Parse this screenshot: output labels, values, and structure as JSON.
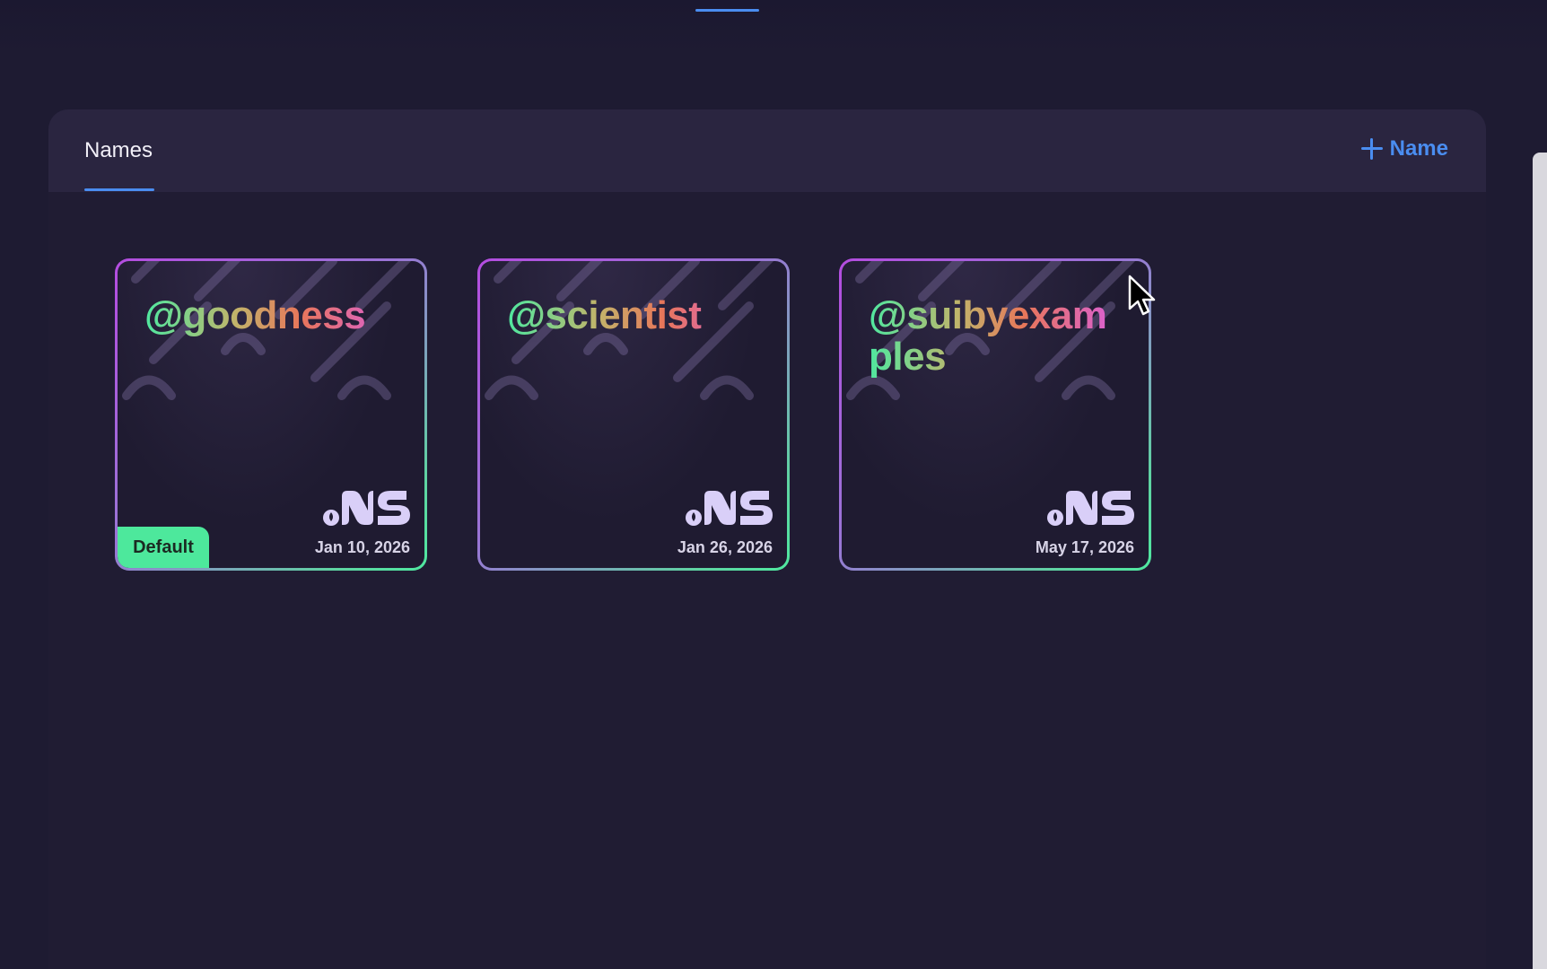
{
  "panel": {
    "tab_label": "Names",
    "add_button_label": "Name"
  },
  "cards": [
    {
      "handle": "@goodness",
      "date": "Jan 10, 2026",
      "is_default": true,
      "badge_label": "Default"
    },
    {
      "handle": "@scientist",
      "date": "Jan 26, 2026",
      "is_default": false
    },
    {
      "handle": "@suibyexamples",
      "date": "May 17, 2026",
      "is_default": false
    }
  ],
  "colors": {
    "background": "#1e1b32",
    "accent": "#4a8df0",
    "default_badge": "#4de89c"
  },
  "icons": {
    "add": "plus-icon",
    "brand": "suins-logo",
    "cursor": "mouse-pointer-icon"
  }
}
